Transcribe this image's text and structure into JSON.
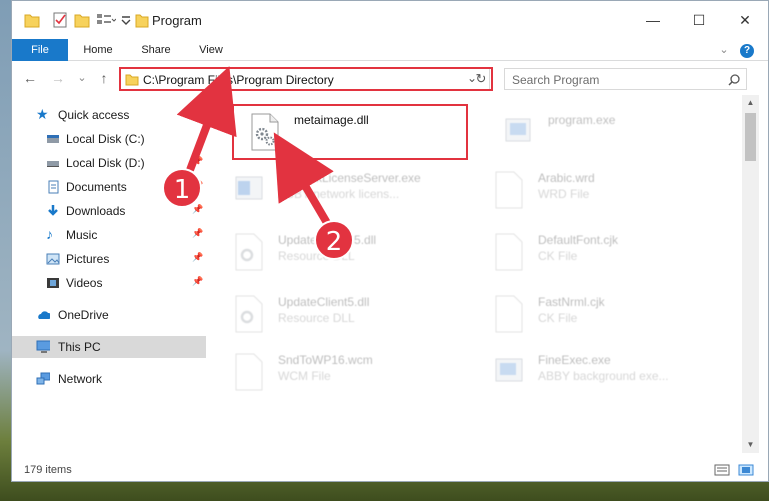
{
  "window": {
    "title": "Program",
    "controls": {
      "minimize": "—",
      "maximize": "☐",
      "close": "✕"
    }
  },
  "ribbon": {
    "tabs": [
      {
        "label": "File"
      },
      {
        "label": "Home"
      },
      {
        "label": "Share"
      },
      {
        "label": "View"
      }
    ],
    "help": "?"
  },
  "navigation": {
    "back": "←",
    "forward": "→",
    "recent": "⌄",
    "up": "↑",
    "address": "C:\\Program Files\\Program Directory",
    "refresh": "↻",
    "dropdown": "⌄",
    "search_placeholder": "Search Program"
  },
  "sidebar": {
    "items": [
      {
        "label": "Quick access",
        "icon": "star-icon"
      },
      {
        "label": "Local Disk (C:)",
        "icon": "drive-icon"
      },
      {
        "label": "Local Disk (D:)",
        "icon": "drive-icon"
      },
      {
        "label": "Documents",
        "icon": "documents-icon"
      },
      {
        "label": "Downloads",
        "icon": "download-icon"
      },
      {
        "label": "Music",
        "icon": "music-icon"
      },
      {
        "label": "Pictures",
        "icon": "pictures-icon"
      },
      {
        "label": "Videos",
        "icon": "videos-icon"
      },
      {
        "label": "OneDrive",
        "icon": "cloud-icon"
      },
      {
        "label": "This PC",
        "icon": "computer-icon"
      },
      {
        "label": "Network",
        "icon": "network-icon"
      }
    ]
  },
  "files": [
    {
      "name": "metaimage.dll",
      "type": ""
    },
    {
      "name": "program.exe",
      "type": ""
    },
    {
      "name": "NetworkLicenseServer.exe",
      "type": "ABBY network licens..."
    },
    {
      "name": "Arabic.wrd",
      "type": "WRD File"
    },
    {
      "name": "UpdateClient65.dll",
      "type": "Resource DLL"
    },
    {
      "name": "DefaultFont.cjk",
      "type": "CK File"
    },
    {
      "name": "UpdateClient5.dll",
      "type": "Resource DLL"
    },
    {
      "name": "FastNrml.cjk",
      "type": "CK File"
    },
    {
      "name": "SndToWP16.wcm",
      "type": "WCM File"
    },
    {
      "name": "FineExec.exe",
      "type": "ABBY background exe..."
    }
  ],
  "status": {
    "item_count": "179 items"
  },
  "annotations": {
    "step1": "1",
    "step2": "2"
  },
  "colors": {
    "accent": "#1979ca",
    "highlight": "#e2333f",
    "selected": "#cce8ff"
  }
}
